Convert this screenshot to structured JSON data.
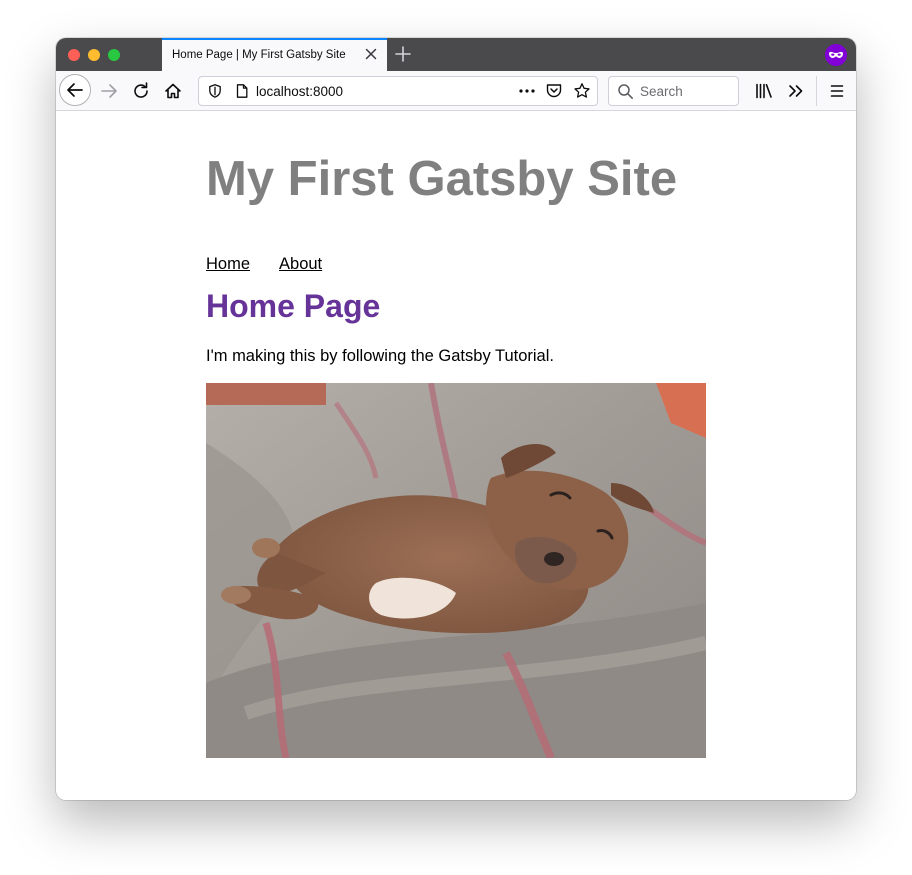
{
  "browser": {
    "tab_title": "Home Page | My First Gatsby Site",
    "url": "localhost:8000",
    "search_placeholder": "Search",
    "accent_color": "#0a84ff",
    "private_browsing_color": "#8000d7"
  },
  "page": {
    "site_title": "My First Gatsby Site",
    "nav": [
      {
        "label": "Home"
      },
      {
        "label": "About"
      }
    ],
    "heading": "Home Page",
    "intro": "I'm making this by following the Gatsby Tutorial.",
    "image": {
      "subject": "brown dog sleeping on a striped blanket bed"
    },
    "heading_color": "#663399",
    "title_color": "#808080"
  }
}
